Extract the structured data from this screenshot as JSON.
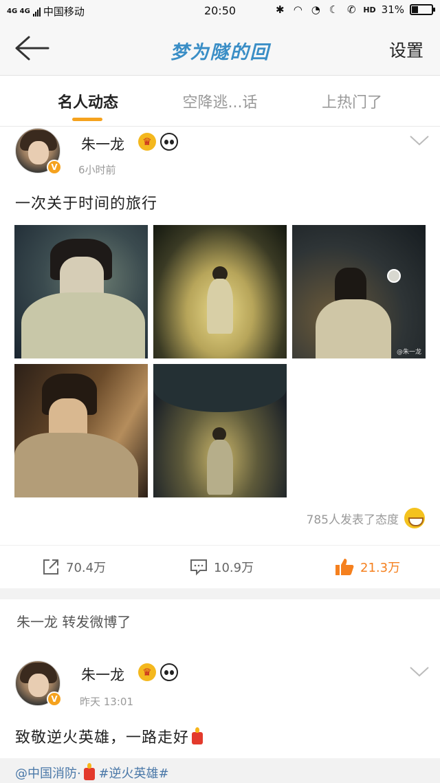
{
  "status_bar": {
    "network": "4G 4G",
    "carrier": "中国移动",
    "time": "20:50",
    "hd": "HD",
    "battery_percent": "31%",
    "battery_level": 0.31
  },
  "nav": {
    "title": "梦为隧的回",
    "settings_label": "设置"
  },
  "tabs": [
    {
      "label": "名人动态",
      "active": true
    },
    {
      "label": "空降逃...话",
      "active": false
    },
    {
      "label": "上热门了",
      "active": false
    }
  ],
  "post1": {
    "username": "朱一龙",
    "time": "6小时前",
    "text": "一次关于时间的旅行",
    "photo_watermark": "@朱一龙",
    "reactions_text": "785人发表了态度",
    "actions": {
      "repost": "70.4万",
      "comment": "10.9万",
      "like": "21.3万"
    }
  },
  "repost_header": "朱一龙 转发微博了",
  "post2": {
    "username": "朱一龙",
    "time": "昨天 13:01",
    "text": "致敬逆火英雄，一路走好",
    "link_mention": "@中国消防",
    "link_tag": "#逆火英雄#"
  },
  "colors": {
    "accent": "#f5a21e",
    "like_active": "#f5801e",
    "link": "#4a78a8",
    "title_blue": "#3a8ec6"
  }
}
